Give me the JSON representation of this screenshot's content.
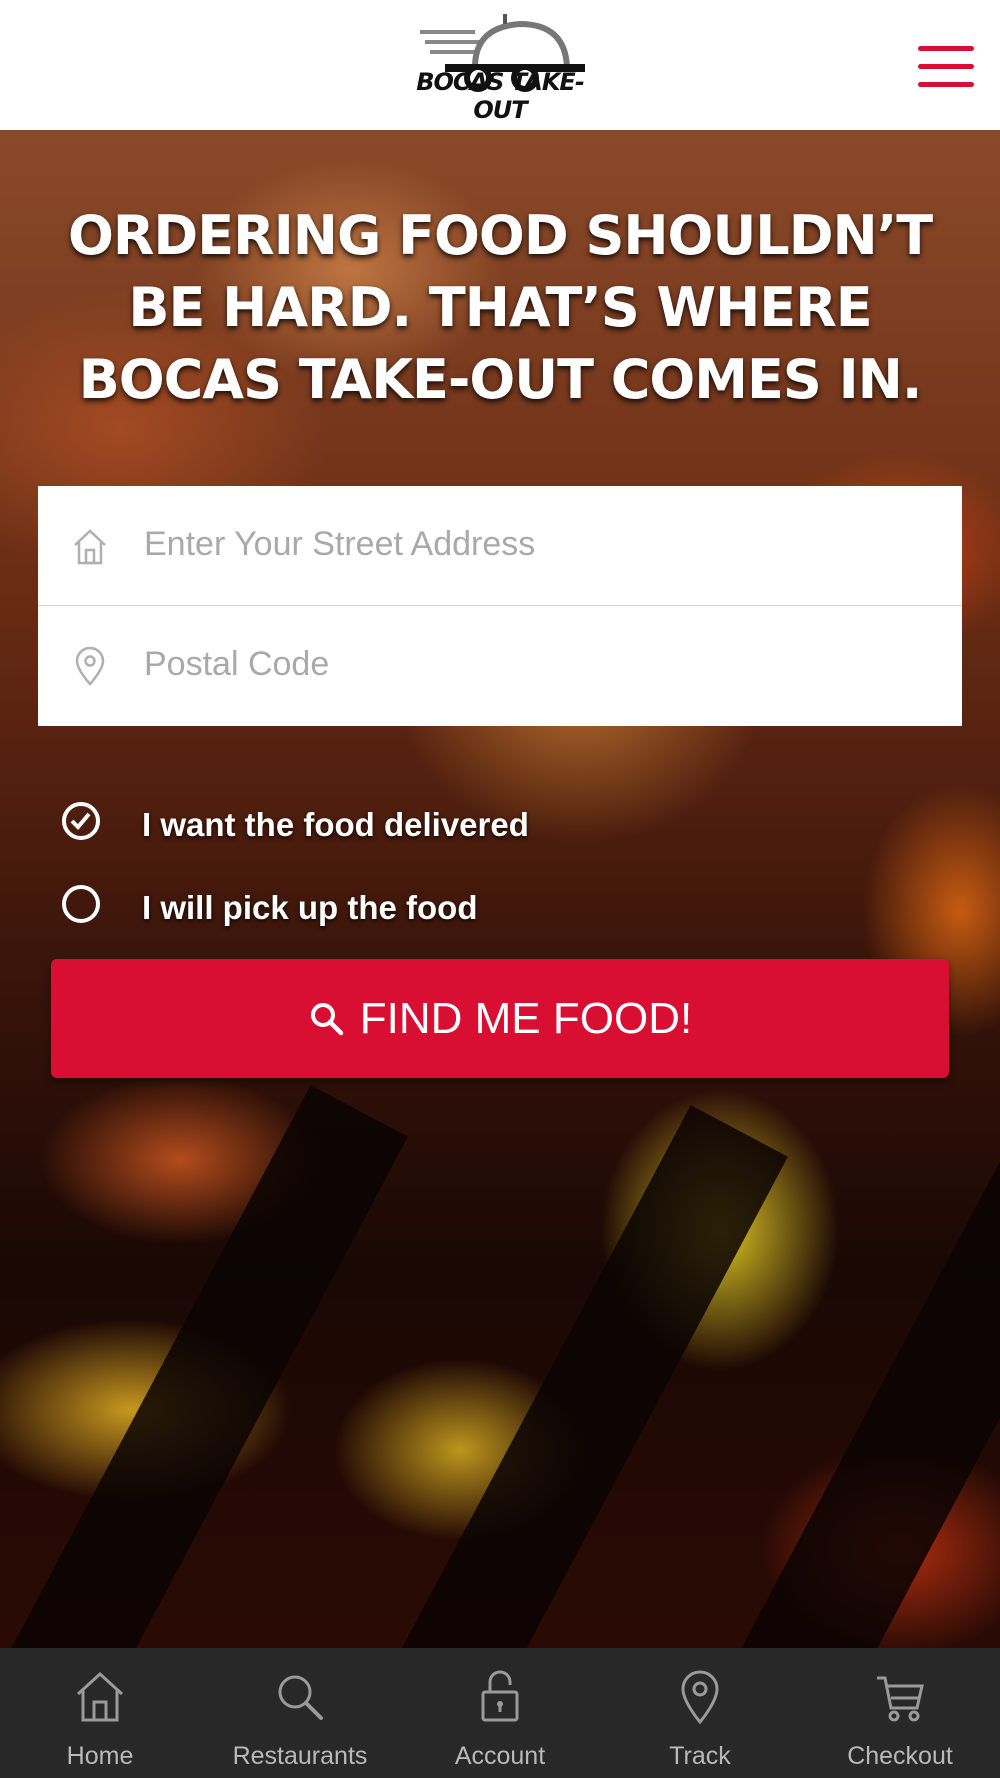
{
  "header": {
    "logo_text": "BOCAS TAKE-OUT",
    "menu_icon": "hamburger-menu-icon",
    "accent_color": "#d80e33"
  },
  "hero": {
    "headline": "ORDERING FOOD SHOULDN’T BE HARD. THAT’S WHERE BOCAS TAKE-OUT COMES IN."
  },
  "address_form": {
    "street_placeholder": "Enter Your Street Address",
    "street_value": "",
    "street_icon": "home-icon",
    "postal_placeholder": "Postal Code",
    "postal_value": "",
    "postal_icon": "location-pin-icon"
  },
  "options": {
    "delivery_label": "I want the food delivered",
    "delivery_selected": true,
    "pickup_label": "I will pick up the food",
    "pickup_selected": false
  },
  "find_button": {
    "label": "FIND ME FOOD!",
    "icon": "search-icon",
    "color": "#d80e33"
  },
  "bottom_nav": {
    "items": [
      {
        "label": "Home",
        "icon": "home-icon"
      },
      {
        "label": "Restaurants",
        "icon": "search-icon"
      },
      {
        "label": "Account",
        "icon": "lock-icon"
      },
      {
        "label": "Track",
        "icon": "location-pin-icon"
      },
      {
        "label": "Checkout",
        "icon": "cart-icon"
      }
    ],
    "background": "#282828"
  }
}
